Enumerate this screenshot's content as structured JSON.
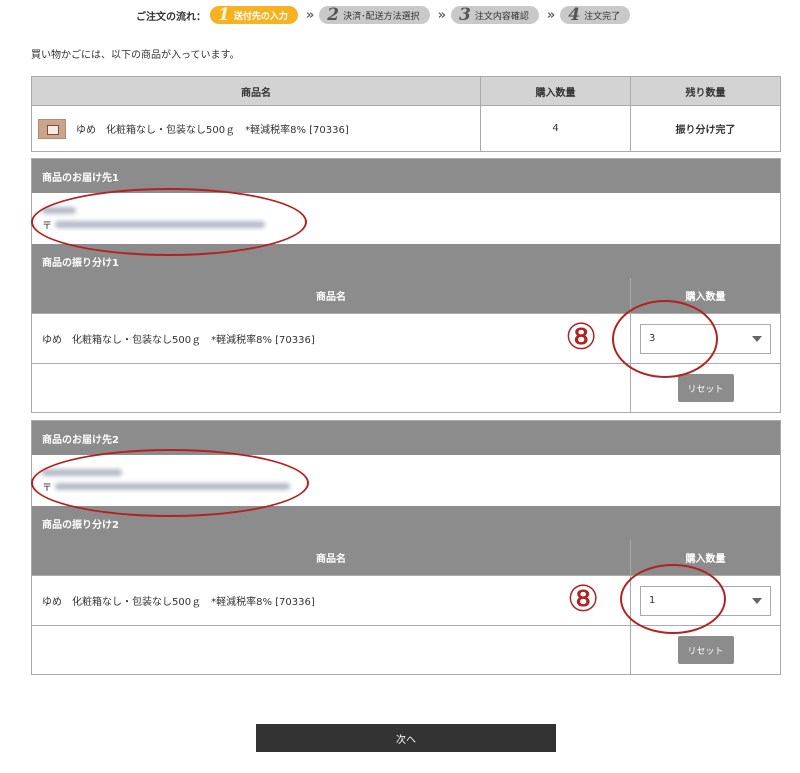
{
  "flow": {
    "label": "ご注文の流れ：",
    "steps": [
      {
        "num": "1",
        "label": "送付先の入力"
      },
      {
        "num": "2",
        "label": "決済･配送方法選択"
      },
      {
        "num": "3",
        "label": "注文内容確認"
      },
      {
        "num": "4",
        "label": "注文完了"
      }
    ],
    "arrow": "»"
  },
  "intro": "買い物かごには、以下の商品が入っています。",
  "cart_table": {
    "headers": [
      "商品名",
      "購入数量",
      "残り数量"
    ],
    "row": {
      "name": "ゆめ　化粧箱なし・包装なし500ｇ　*軽減税率8% [70336]",
      "qty": "4",
      "remaining": "振り分け完了"
    }
  },
  "deliveries": [
    {
      "dest_header": "商品のお届け先1",
      "postal_mark": "〒",
      "alloc_header": "商品の振り分け1",
      "col_headers": [
        "商品名",
        "購入数量"
      ],
      "item": "ゆめ　化粧箱なし・包装なし500ｇ　*軽減税率8% [70336]",
      "qty_selected": "3",
      "reset_label": "リセット",
      "marker": "⑧"
    },
    {
      "dest_header": "商品のお届け先2",
      "postal_mark": "〒",
      "alloc_header": "商品の振り分け2",
      "col_headers": [
        "商品名",
        "購入数量"
      ],
      "item": "ゆめ　化粧箱なし・包装なし500ｇ　*軽減税率8% [70336]",
      "qty_selected": "1",
      "reset_label": "リセット",
      "marker": "⑧"
    }
  ],
  "next_button": "次へ",
  "colors": {
    "active_step": "#f5b324",
    "header_dark": "#8c8c8c",
    "header_light": "#d3d3d3",
    "annotation": "#b22222",
    "next_button": "#333333"
  }
}
